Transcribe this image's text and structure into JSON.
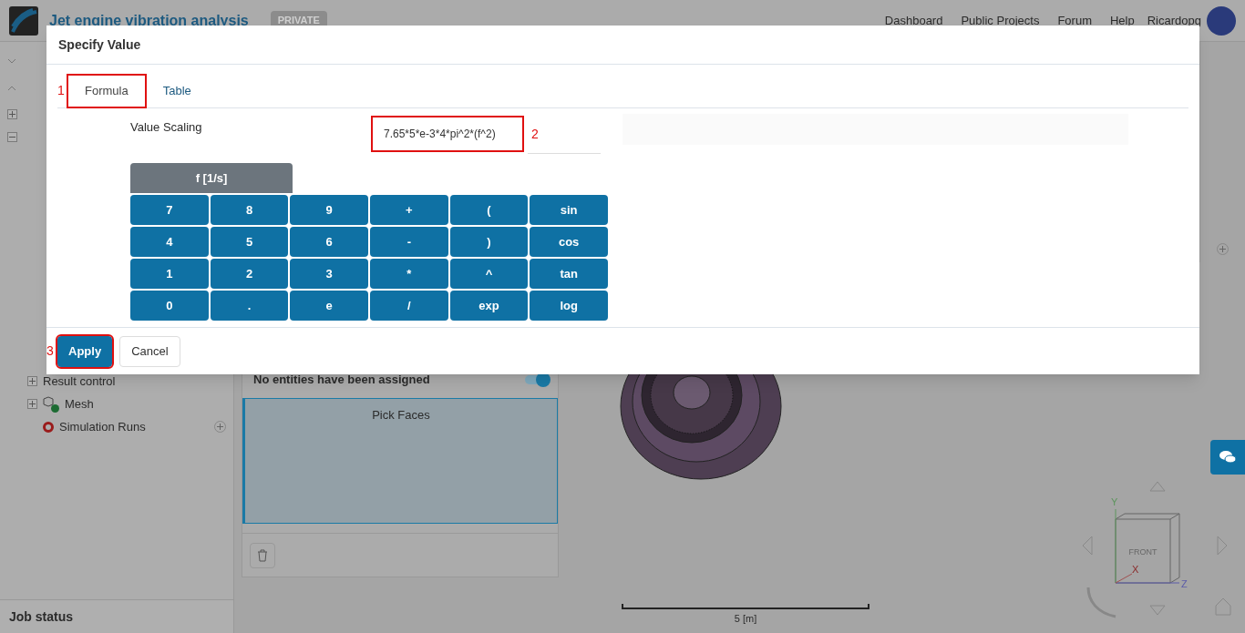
{
  "header": {
    "title": "Jet engine vibration analysis",
    "badge": "PRIVATE",
    "nav": [
      "Dashboard",
      "Public Projects",
      "Forum",
      "Help"
    ],
    "user": "Ricardopg"
  },
  "sidebar": {
    "tree": [
      {
        "label": "Result control",
        "kind": "plain",
        "expanded": false
      },
      {
        "label": "Mesh",
        "kind": "mesh",
        "color": "#1d6b33",
        "expanded": false
      },
      {
        "label": "Simulation Runs",
        "kind": "runs",
        "color": "#9a1b1b"
      }
    ],
    "job_status": "Job status"
  },
  "panel": {
    "assignment": "No entities have been assigned",
    "toggle_on": true,
    "pick_label": "Pick Faces"
  },
  "viewport": {
    "scale_label": "5 [m]",
    "cube_face": "FRONT",
    "axes": [
      "X",
      "Y",
      "Z"
    ]
  },
  "dialog": {
    "title": "Specify Value",
    "tabs": [
      {
        "label": "Formula",
        "selected": true,
        "marker": "1"
      },
      {
        "label": "Table",
        "selected": false
      }
    ],
    "field_label": "Value Scaling",
    "field_value": "7.65*5*e-3*4*pi^2*(f^2)",
    "field_marker": "2",
    "variable": "f [1/s]",
    "keys": [
      "7",
      "8",
      "9",
      "+",
      "(",
      "sin",
      "4",
      "5",
      "6",
      "-",
      ")",
      "cos",
      "1",
      "2",
      "3",
      "*",
      "^",
      "tan",
      "0",
      ".",
      "e",
      "/",
      "exp",
      "log"
    ],
    "buttons": [
      {
        "label": "Apply",
        "kind": "primary",
        "marker": "3"
      },
      {
        "label": "Cancel",
        "kind": "secondary"
      }
    ]
  }
}
